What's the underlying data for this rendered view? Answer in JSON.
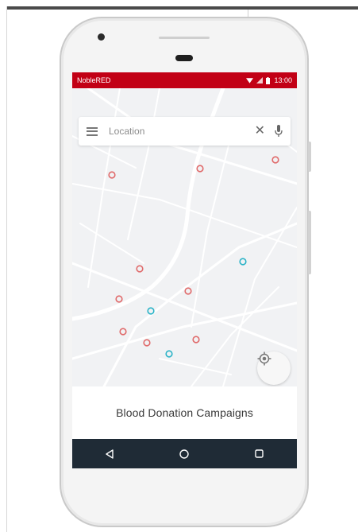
{
  "status_bar": {
    "app_name": "NobleRED",
    "time": "13:00",
    "bg_color": "#c20015"
  },
  "search": {
    "placeholder": "Location",
    "menu_icon": "menu-icon",
    "clear_icon": "close-icon",
    "voice_icon": "mic-icon"
  },
  "map": {
    "marker_colors": {
      "campaign": "#e06a6a",
      "other": "#2bb3c7"
    },
    "locate_icon": "my-location-icon"
  },
  "panel": {
    "title": "Blood Donation Campaigns"
  },
  "nav": {
    "back": "back-icon",
    "home": "home-icon",
    "recents": "recents-icon"
  }
}
